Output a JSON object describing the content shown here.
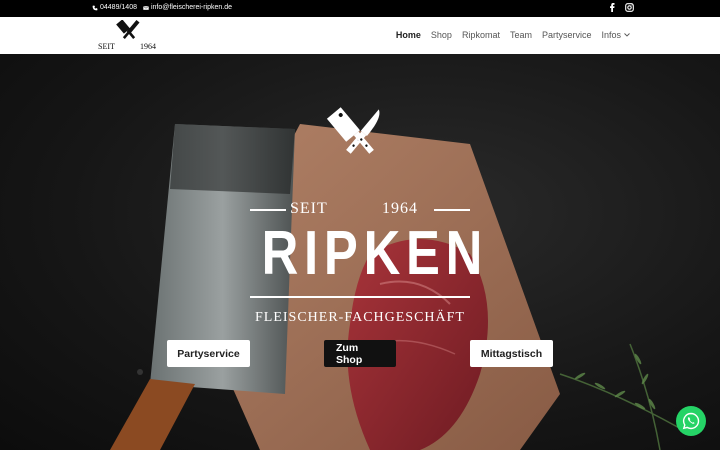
{
  "topbar": {
    "phone": "04489/1408",
    "email": "info@fleischerei-ripken.de",
    "social": [
      "facebook-icon",
      "instagram-icon"
    ]
  },
  "header": {
    "logo_seit": "SEIT",
    "logo_year": "1964",
    "nav": [
      {
        "label": "Home",
        "active": true
      },
      {
        "label": "Shop"
      },
      {
        "label": "Ripkomat"
      },
      {
        "label": "Team"
      },
      {
        "label": "Partyservice"
      },
      {
        "label": "Infos",
        "dropdown": true
      }
    ]
  },
  "hero": {
    "seit": "SEIT",
    "year": "1964",
    "brand": "RIPKEN",
    "subtitle": "FLEISCHER-FACHGESCHÄFT",
    "buttons": [
      {
        "label": "Partyservice",
        "style": "light"
      },
      {
        "label": "Zum Shop",
        "style": "dark"
      },
      {
        "label": "Mittagstisch",
        "style": "light"
      }
    ]
  },
  "colors": {
    "whatsapp": "#25d366",
    "topbar": "#000000"
  }
}
